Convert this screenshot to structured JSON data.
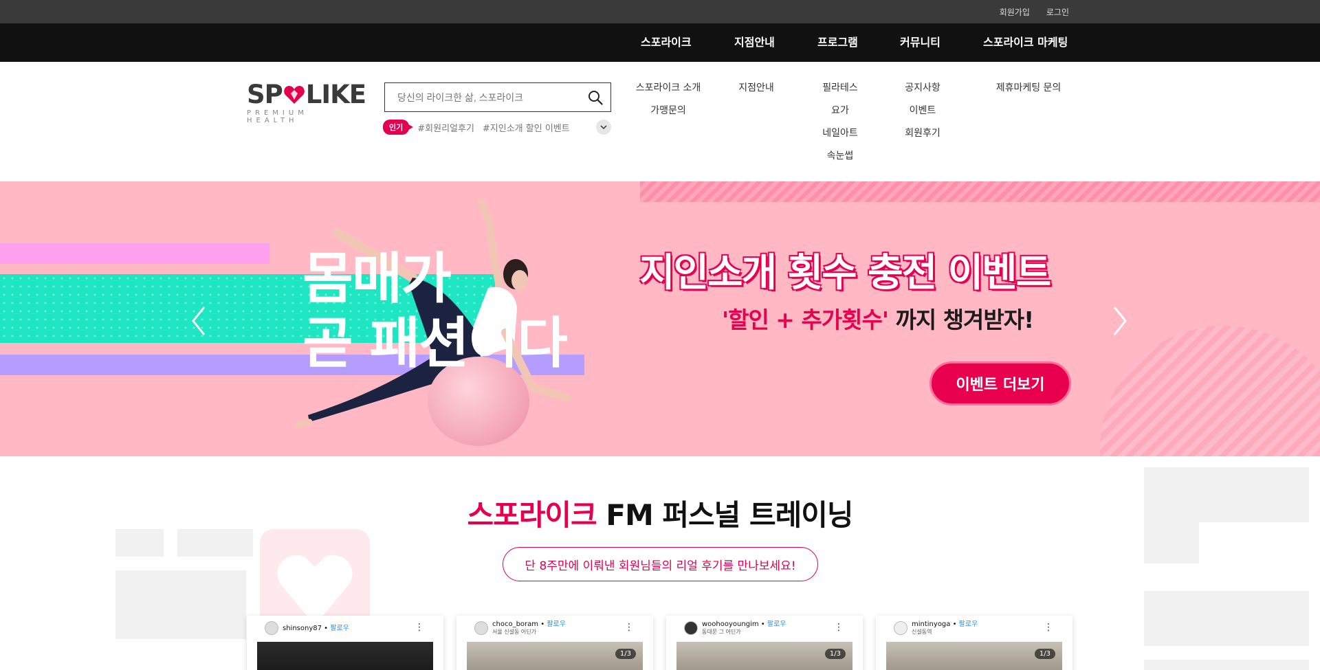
{
  "topbar": {
    "signup": "회원가입",
    "login": "로그인"
  },
  "gnb": [
    "스포라이크",
    "지점안내",
    "프로그램",
    "커뮤니티",
    "스포라이크 마케팅"
  ],
  "logo": {
    "brand_left": "SP",
    "brand_right": "LIKE",
    "tagline": "PREMIUM HEALTH"
  },
  "search": {
    "placeholder": "당신의 라이크한 삶, 스포라이크"
  },
  "popular": {
    "badge": "인기",
    "tags": [
      "#회원리얼후기",
      "#지인소개 할인 이벤트"
    ]
  },
  "submenu": {
    "col1": [
      "스포라이크 소개",
      "가맹문의"
    ],
    "col2": [
      "지점안내"
    ],
    "col3": [
      "필라테스",
      "요가",
      "네일아트",
      "속눈썹"
    ],
    "col4": [
      "공지사항",
      "이벤트",
      "회원후기"
    ],
    "col5": [
      "제휴마케팅 문의"
    ]
  },
  "hero": {
    "slogan": "몸매가\n곧 패션이다",
    "title": "지인소개 횟수 충전 이벤트",
    "subtitle_part1": "'할인 + 추가횟수'",
    "subtitle_part2": " 까지 챙겨받자!",
    "cta": "이벤트 더보기"
  },
  "section": {
    "title_accent": "스포라이크",
    "title_rest": " FM 퍼스널 트레이닝",
    "pill": "단 8주만에 이뤄낸 회원님들의 리얼 후기를 만나보세요!"
  },
  "cards": [
    {
      "user": "shinsony87",
      "follow": "팔로우",
      "location": "",
      "counter": ""
    },
    {
      "user": "choco_boram",
      "follow": "팔로우",
      "location": "서울 신설동 어딘가",
      "counter": "1/3"
    },
    {
      "user": "woohooyoungim",
      "follow": "팔로우",
      "location": "동대문 그 어딘가",
      "counter": "1/3"
    },
    {
      "user": "mintinyoga",
      "follow": "팔로우",
      "location": "신설동역",
      "counter": "1/3"
    }
  ],
  "colors": {
    "accent": "#e4004f",
    "topbar": "#3a3a3a",
    "gnb": "#111111",
    "hero_bg": "#ffb8c4"
  }
}
